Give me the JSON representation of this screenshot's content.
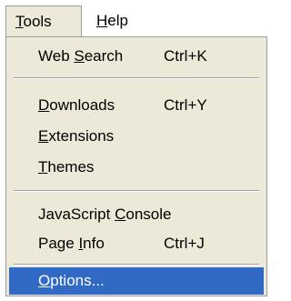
{
  "menubar": {
    "items": [
      {
        "mnemonic": "T",
        "rest": "ools"
      },
      {
        "mnemonic": "H",
        "rest": "elp"
      }
    ]
  },
  "menu": {
    "web_search": {
      "pre": "Web ",
      "mnemonic": "S",
      "post": "earch",
      "shortcut": "Ctrl+K"
    },
    "downloads": {
      "pre": "",
      "mnemonic": "D",
      "post": "ownloads",
      "shortcut": "Ctrl+Y"
    },
    "extensions": {
      "pre": "",
      "mnemonic": "E",
      "post": "xtensions"
    },
    "themes": {
      "pre": "",
      "mnemonic": "T",
      "post": "hemes"
    },
    "js_console": {
      "pre": "JavaScript ",
      "mnemonic": "C",
      "post": "onsole"
    },
    "page_info": {
      "pre": "Page ",
      "mnemonic": "I",
      "post": "nfo",
      "shortcut": "Ctrl+J"
    },
    "options": {
      "pre": "",
      "mnemonic": "O",
      "post": "ptions...",
      "selected": true
    }
  },
  "colors": {
    "menu_background": "#ece9d8",
    "highlight": "#316ac5",
    "highlight_text": "#ffffff"
  }
}
